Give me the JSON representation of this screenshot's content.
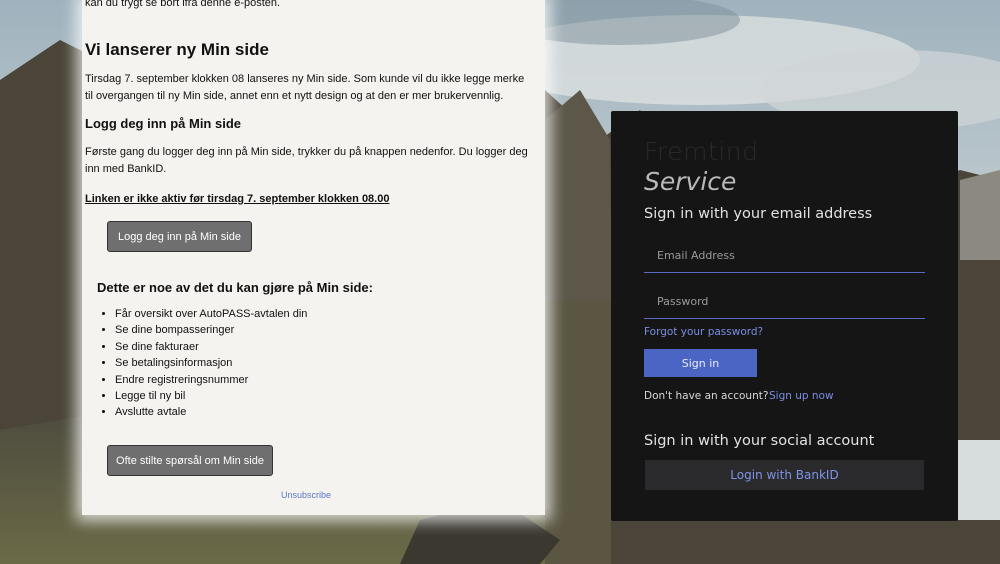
{
  "email": {
    "top_fragment": "kan du trygt se bort ifra denne e-posten.",
    "title": "Vi lanserer ny Min side",
    "paragraph1": "Tirsdag 7. september klokken 08 lanseres ny Min side. Som kunde vil du ikke legge merke til overgangen til ny Min side, annet enn et nytt design og at den er mer brukervennlig.",
    "subtitle": "Logg deg inn på Min side",
    "paragraph2": "Første gang du logger deg inn på Min side, trykker du på knappen nedenfor. Du logger deg inn med BankID.",
    "notice": "Linken er ikke aktiv før tirsdag 7. september klokken 08.00",
    "login_button": "Logg deg inn på Min side",
    "list_heading": "Dette er noe av det du kan gjøre på Min side:",
    "list_items": [
      "Får oversikt over AutoPASS-avtalen din",
      "Se dine bompasseringer",
      "Se dine fakturaer",
      "Se betalingsinformasjon",
      "Endre registreringsnummer",
      "Legge til ny bil",
      "Avslutte avtale"
    ],
    "faq_button": "Ofte stilte spørsål om Min side",
    "unsubscribe": "Unsubscribe"
  },
  "signin": {
    "logo_line1": "Fremtind",
    "logo_line2": "Service",
    "heading": "Sign in with your email address",
    "email_placeholder": "Email Address",
    "password_placeholder": "Password",
    "forgot_link": "Forgot your password?",
    "signin_button": "Sign in",
    "no_account_text": "Don't have an account?",
    "signup_link": "Sign up now",
    "social_heading": "Sign in with your social account",
    "bankid_button": "Login with BankID"
  },
  "colors": {
    "accent": "#4a65c4",
    "link": "#7a8ee0",
    "panel_dark": "#151516",
    "email_bg": "#f5f3f0"
  }
}
